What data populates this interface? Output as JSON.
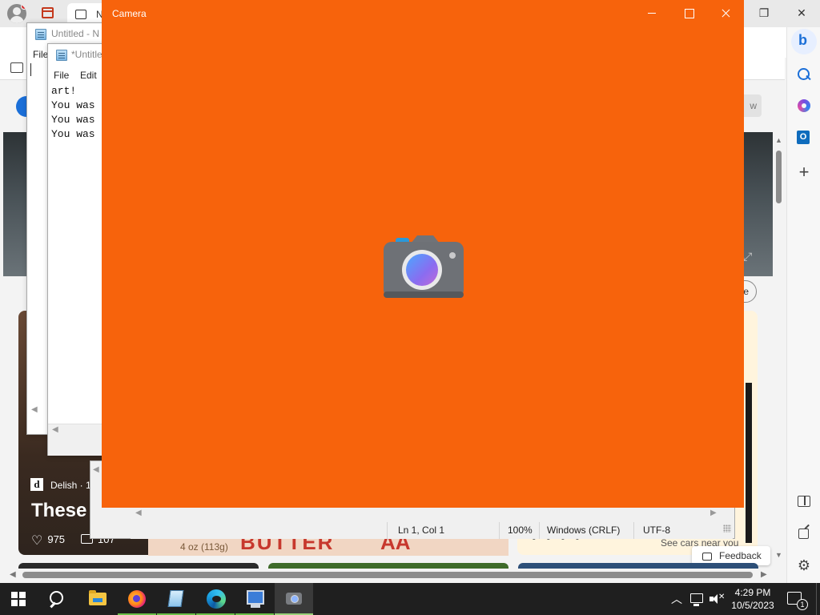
{
  "edge": {
    "tab_label": "N",
    "more_label": "•••",
    "banner_button": "w",
    "hero_button": "e",
    "card": {
      "source_icon": "d",
      "source": "Delish · 1",
      "title": "These Ar",
      "likes": "975",
      "comments": "107"
    },
    "card_strip": {
      "sub": "4 oz (113g)",
      "word": "BUTTER",
      "tail": "AA"
    },
    "cars_near": "See cars near you",
    "dots": "• • • •",
    "feedback": "Feedback",
    "sidebar_bing_letter": "b",
    "sidebar_plus": "+",
    "sidebar_gear": "⚙",
    "icons": [
      "profile-icon",
      "tab-actions-icon",
      "folder-icon",
      "bing-icon",
      "search-icon",
      "copilot-icon",
      "outlook-icon",
      "add-icon",
      "split-screen-icon",
      "open-external-icon",
      "settings-icon"
    ]
  },
  "notepad1": {
    "title": "Untitled - N",
    "menu_file": "File"
  },
  "notepad2": {
    "title": "*Untitle",
    "menu_file": "File",
    "menu_edit": "Edit",
    "lines": [
      "art!",
      "You was",
      "You was",
      "You was"
    ]
  },
  "notepad3": {
    "position": "Ln 1, Col 1",
    "zoom": "100%",
    "line_ending": "Windows (CRLF)",
    "encoding": "UTF-8"
  },
  "camera": {
    "title": "Camera",
    "background_color": "#f7630c"
  },
  "taskbar": {
    "time": "4:29 PM",
    "date": "10/5/2023",
    "notification_count": "1",
    "apps": [
      "File Explorer",
      "Firefox",
      "Notepad",
      "Microsoft Edge",
      "This PC",
      "Camera"
    ]
  }
}
